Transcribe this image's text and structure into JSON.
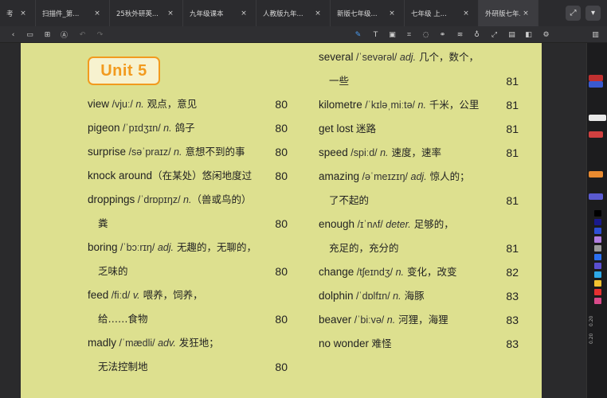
{
  "tabs": [
    {
      "label": "考",
      "close": "×"
    },
    {
      "label": "扫描件_第...",
      "close": "×"
    },
    {
      "label": "25秋外研英...",
      "close": "×"
    },
    {
      "label": "九年级课本",
      "close": "×"
    },
    {
      "label": "人教版九年...",
      "close": "×"
    },
    {
      "label": "新版七年级...",
      "close": "×"
    },
    {
      "label": "七年级 上...",
      "close": "×"
    },
    {
      "label": "外研版七年...",
      "close": "×"
    }
  ],
  "tabbar_buttons": [
    "⤢",
    "▾"
  ],
  "toolbar": {
    "left": [
      "‹",
      "▭",
      "⊞",
      "Ⓐ",
      "↶",
      "↷"
    ],
    "right": [
      "✎",
      "T",
      "▣",
      "⌗",
      "◌",
      "⚭",
      "≋",
      "♁",
      "⤢",
      "▤",
      "◧",
      "⚙",
      "▥"
    ]
  },
  "unit_title": "Unit 5",
  "left_entries": [
    {
      "word": "view",
      "phon": " /vjuː/ ",
      "pos": "n.",
      "zh": " 观点，意见",
      "page": "80"
    },
    {
      "word": "pigeon",
      "phon": " /ˈpɪdʒɪn/ ",
      "pos": "n.",
      "zh": " 鸽子",
      "page": "80"
    },
    {
      "word": "surprise",
      "phon": " /səˈpraɪz/ ",
      "pos": "n.",
      "zh": " 意想不到的事",
      "page": "80"
    },
    {
      "word": "knock around",
      "phon": "",
      "pos": "",
      "zh": "（在某处）悠闲地度过",
      "page": "80"
    },
    {
      "word": "droppings",
      "phon": " /ˈdrɒpɪŋz/ ",
      "pos": "n.",
      "zh": "（兽或鸟的）",
      "page": ""
    },
    {
      "word": "",
      "phon": "",
      "pos": "",
      "zh": "粪",
      "page": "80",
      "indent": true
    },
    {
      "word": "boring",
      "phon": " /ˈbɔːrɪŋ/ ",
      "pos": "adj.",
      "zh": " 无趣的，无聊的，",
      "page": ""
    },
    {
      "word": "",
      "phon": "",
      "pos": "",
      "zh": "乏味的",
      "page": "80",
      "indent": true
    },
    {
      "word": "feed",
      "phon": " /fiːd/ ",
      "pos": "v.",
      "zh": " 喂养，饲养，",
      "page": ""
    },
    {
      "word": "",
      "phon": "",
      "pos": "",
      "zh": "给……食物",
      "page": "80",
      "indent": true
    },
    {
      "word": "madly",
      "phon": " /ˈmædli/ ",
      "pos": "adv.",
      "zh": " 发狂地；",
      "page": ""
    },
    {
      "word": "",
      "phon": "",
      "pos": "",
      "zh": "无法控制地",
      "page": "80",
      "indent": true
    }
  ],
  "right_entries": [
    {
      "word": "several",
      "phon": " /ˈsevərəl/ ",
      "pos": "adj.",
      "zh": " 几个，数个，",
      "page": ""
    },
    {
      "word": "",
      "phon": "",
      "pos": "",
      "zh": "一些",
      "page": "81",
      "indent": true
    },
    {
      "word": "kilometre",
      "phon": " /ˈkɪləˌmiːtə/ ",
      "pos": "n.",
      "zh": " 千米，公里",
      "page": "81"
    },
    {
      "word": "get lost",
      "phon": " ",
      "pos": "",
      "zh": "迷路",
      "page": "81"
    },
    {
      "word": "speed",
      "phon": " /spiːd/ ",
      "pos": "n.",
      "zh": " 速度，速率",
      "page": "81"
    },
    {
      "word": "amazing",
      "phon": " /əˈmeɪzɪŋ/ ",
      "pos": "adj.",
      "zh": " 惊人的；",
      "page": ""
    },
    {
      "word": "",
      "phon": "",
      "pos": "",
      "zh": "了不起的",
      "page": "81",
      "indent": true
    },
    {
      "word": "enough",
      "phon": " /ɪˈnʌf/ ",
      "pos": "deter.",
      "zh": " 足够的，",
      "page": ""
    },
    {
      "word": "",
      "phon": "",
      "pos": "",
      "zh": "充足的，充分的",
      "page": "81",
      "indent": true
    },
    {
      "word": "change",
      "phon": " /tʃeɪndʒ/ ",
      "pos": "n.",
      "zh": " 变化，改变",
      "page": "82"
    },
    {
      "word": "dolphin",
      "phon": " /ˈdɒlfɪn/ ",
      "pos": "n.",
      "zh": " 海豚",
      "page": "83"
    },
    {
      "word": "beaver",
      "phon": " /ˈbiːvə/ ",
      "pos": "n.",
      "zh": " 河狸，海狸",
      "page": "83"
    },
    {
      "word": "no wonder",
      "phon": " ",
      "pos": "",
      "zh": "难怪",
      "page": "83"
    }
  ],
  "colors": {
    "page_bg": "#dde08f",
    "unit_orange": "#f29a1e",
    "swatches": [
      "#000000",
      "#1a1a8c",
      "#2e4fd6",
      "#b07de0",
      "#9a9a9a",
      "#2b6ff0",
      "#5a4fd0",
      "#2ea8e8",
      "#f2c230",
      "#e53030",
      "#d94a8a"
    ]
  },
  "right_panel": {
    "pen_colors": [
      "#c03030",
      "#3a5ad0",
      "#e8e8e8",
      "#d04040",
      "#e88a30",
      "#5a5ad0"
    ],
    "labels": [
      "0.20",
      "0.20"
    ]
  }
}
